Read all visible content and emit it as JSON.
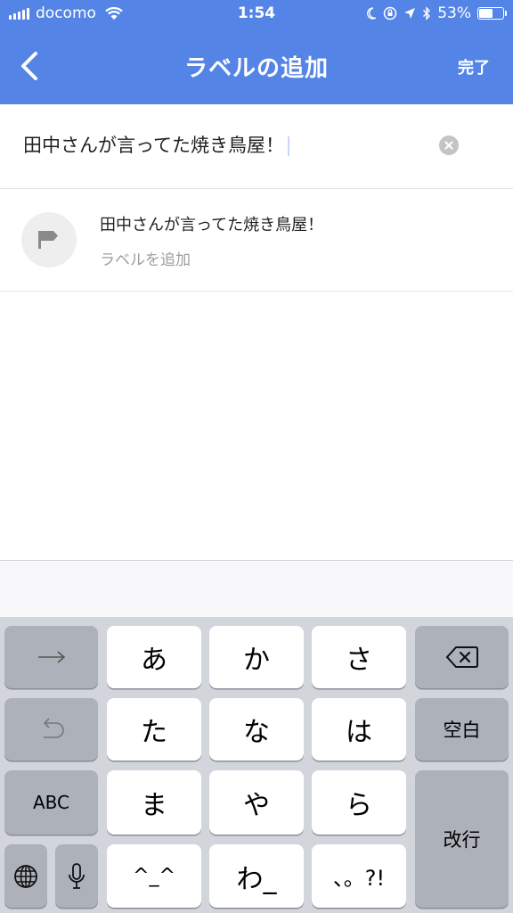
{
  "status_bar": {
    "carrier": "docomo",
    "time": "1:54",
    "battery_percent": "53%",
    "battery_level": 0.53
  },
  "nav": {
    "title": "ラベルの追加",
    "done_label": "完了"
  },
  "search": {
    "value": "田中さんが言ってた焼き鳥屋！"
  },
  "result": {
    "title": "田中さんが言ってた焼き鳥屋！",
    "subtitle": "ラベルを追加"
  },
  "keyboard": {
    "keys": {
      "a": "あ",
      "ka": "か",
      "sa": "さ",
      "ta": "た",
      "na": "な",
      "ha": "は",
      "ma": "ま",
      "ya": "や",
      "ra": "ら",
      "kao": "^_^",
      "wa": "わ_",
      "punct": "、。?!",
      "space": "空白",
      "enter": "改行",
      "abc": "ABC"
    }
  },
  "colors": {
    "accent": "#5485e6",
    "keyboard_bg": "#d2d5db",
    "key_light": "#ffffff",
    "key_dark": "#acb1ba"
  }
}
